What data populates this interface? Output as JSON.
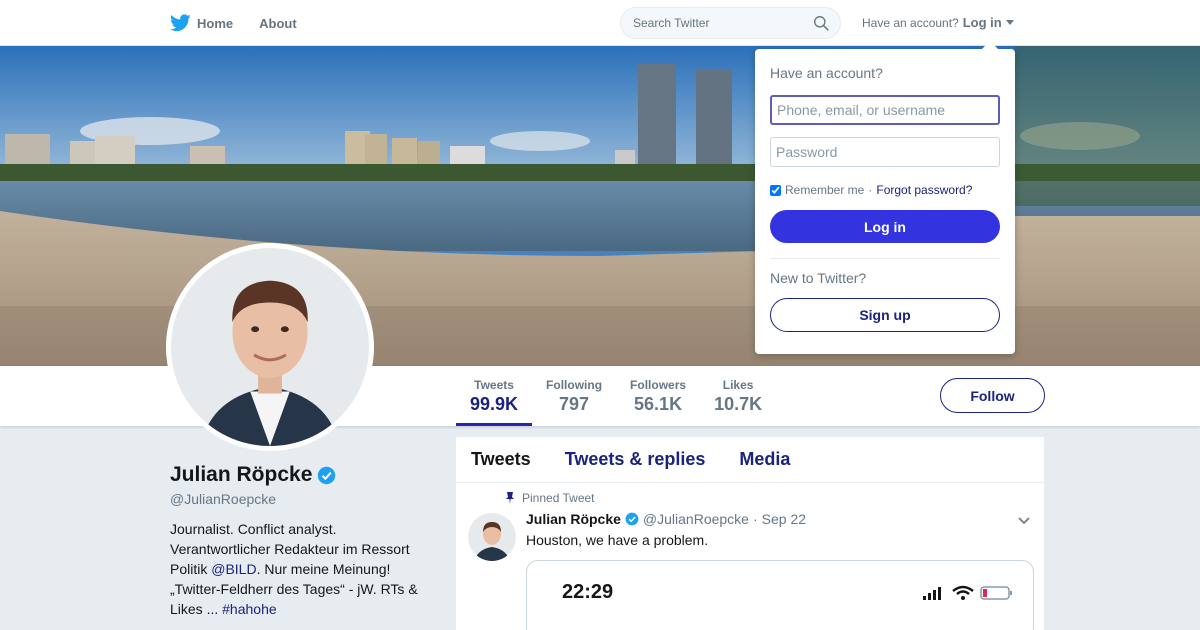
{
  "nav": {
    "home_label": "Home",
    "about_label": "About",
    "search_placeholder": "Search Twitter",
    "have_account_text": "Have an account?",
    "login_label": "Log in"
  },
  "stats": [
    {
      "label": "Tweets",
      "value": "99.9K"
    },
    {
      "label": "Following",
      "value": "797"
    },
    {
      "label": "Followers",
      "value": "56.1K"
    },
    {
      "label": "Likes",
      "value": "10.7K"
    }
  ],
  "follow_label": "Follow",
  "profile": {
    "name": "Julian Röpcke",
    "handle": "@JulianRoepcke",
    "bio_line1": "Journalist. Conflict analyst. Verantwortlicher Redakteur im Ressort Politik ",
    "bio_mention": "@BILD",
    "bio_line2": ". Nur meine Meinung! „Twitter-Feldherr des Tages“ - jW. RTs & Likes ... ",
    "bio_hashtag": "#hahohe"
  },
  "tabs": [
    "Tweets",
    "Tweets & replies",
    "Media"
  ],
  "tweet": {
    "pinned_label": "Pinned Tweet",
    "name": "Julian Röpcke",
    "handle": "@JulianRoepcke",
    "separator": "·",
    "date": "Sep 22",
    "text": "Houston, we have a problem.",
    "media_time": "22:29"
  },
  "login": {
    "title": "Have an account?",
    "username_placeholder": "Phone, email, or username",
    "password_placeholder": "Password",
    "remember_label": "Remember me",
    "separator": "·",
    "forgot_label": "Forgot password?",
    "login_button": "Log in",
    "new_text": "New to Twitter?",
    "signup_button": "Sign up"
  },
  "colors": {
    "brand": "#1da1f2",
    "accent": "#1a237e",
    "login_button": "#3333e0"
  }
}
